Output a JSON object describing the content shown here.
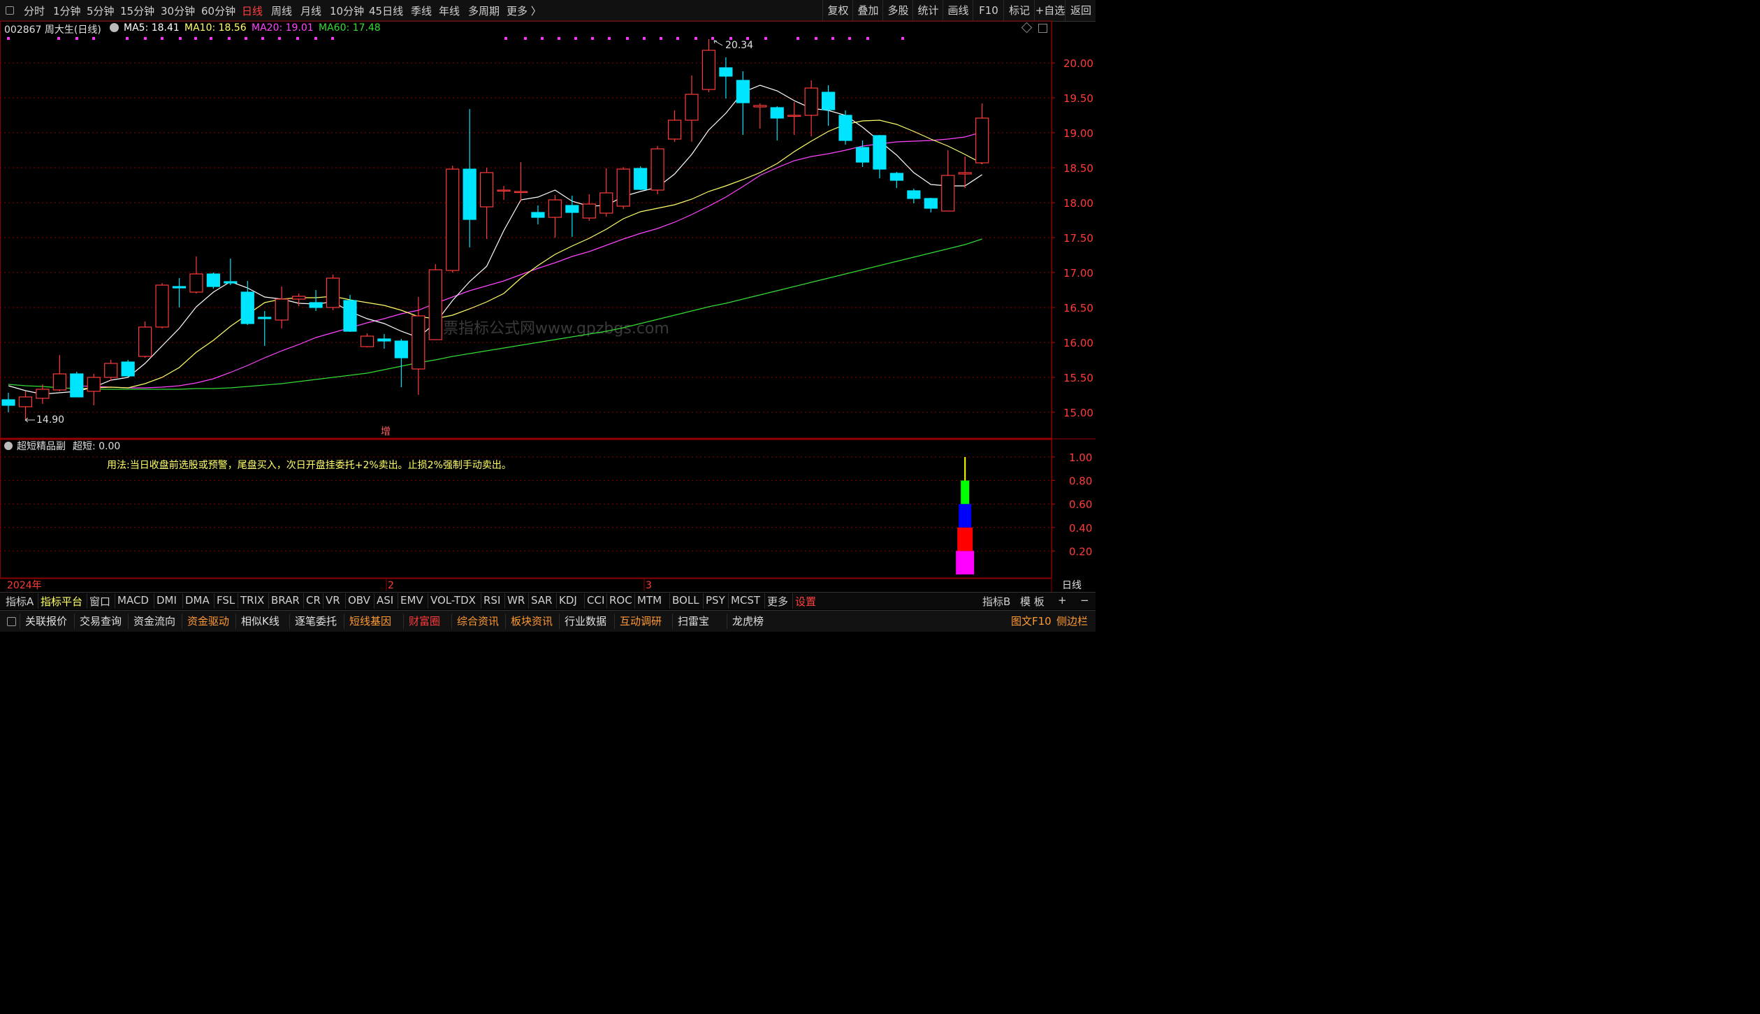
{
  "topbar": {
    "periods": [
      "分时",
      "1分钟",
      "5分钟",
      "15分钟",
      "30分钟",
      "60分钟",
      "日线",
      "周线",
      "月线",
      "10分钟",
      "45日线",
      "季线",
      "年线",
      "多周期",
      "更多 〉"
    ],
    "active_index": 6,
    "right_buttons": [
      "复权",
      "叠加",
      "多股",
      "统计",
      "画线",
      "F10",
      "标记",
      "+自选",
      "返回"
    ]
  },
  "info": {
    "code_name": "002867 周大生(日线)",
    "ma5": "MA5: 18.41",
    "ma10": "MA10: 18.56",
    "ma20": "MA20: 19.01",
    "ma60": "MA60: 17.48"
  },
  "colors": {
    "up": "#ff3b3b",
    "down": "#00e5ff",
    "ma5": "#ffffff",
    "ma10": "#ffff66",
    "ma20": "#ff44ff",
    "ma60": "#33dd33",
    "grid": "#8b0000"
  },
  "price_axis": [
    "20.00",
    "19.50",
    "19.00",
    "18.50",
    "18.00",
    "17.50",
    "17.00",
    "16.50",
    "16.00",
    "15.50",
    "15.00"
  ],
  "annotations": {
    "high": "20.34",
    "low": "14.90",
    "marker": "增",
    "watermark": "股票指标公式网www.gpzbgs.com"
  },
  "indicator": {
    "title": "超短精品副",
    "value": "超短: 0.00",
    "note": "用法:当日收盘前选股或预警，尾盘买入，次日开盘挂委托+2%卖出。止损2%强制手动卖出。",
    "axis": [
      "1.00",
      "0.80",
      "0.60",
      "0.40",
      "0.20"
    ]
  },
  "time_axis": {
    "year": "2024年",
    "m2": "2",
    "m3": "3",
    "period": "日线"
  },
  "indicator_tabs": [
    "指标A",
    "指标平台",
    "窗口",
    "MACD",
    "DMI",
    "DMA",
    "FSL",
    "TRIX",
    "BRAR",
    "CR",
    "VR",
    "OBV",
    "ASI",
    "EMV",
    "VOL-TDX",
    "RSI",
    "WR",
    "SAR",
    "KDJ",
    "CCI",
    "ROC",
    "MTM",
    "BOLL",
    "PSY",
    "MCST",
    "更多",
    "设置"
  ],
  "indicator_tabs_right": [
    "指标B",
    "模 板",
    "+",
    "−"
  ],
  "function_bar": [
    "关联报价",
    "交易查询",
    "资金流向",
    "资金驱动",
    "相似K线",
    "逐笔委托",
    "短线基因",
    "财富圈",
    "综合资讯",
    "板块资讯",
    "行业数据",
    "互动调研",
    "扫雷宝",
    "龙虎榜"
  ],
  "function_bar_right": [
    "图文F10",
    "侧边栏"
  ],
  "chart_data": {
    "type": "candlestick",
    "ylim": [
      14.75,
      20.55
    ],
    "candles": [
      {
        "o": 15.18,
        "h": 15.28,
        "l": 15.0,
        "c": 15.1
      },
      {
        "o": 15.08,
        "h": 15.3,
        "l": 14.9,
        "c": 15.22
      },
      {
        "o": 15.2,
        "h": 15.4,
        "l": 15.12,
        "c": 15.33
      },
      {
        "o": 15.32,
        "h": 15.82,
        "l": 15.3,
        "c": 15.55
      },
      {
        "o": 15.55,
        "h": 15.58,
        "l": 15.22,
        "c": 15.22
      },
      {
        "o": 15.3,
        "h": 15.55,
        "l": 15.1,
        "c": 15.5
      },
      {
        "o": 15.5,
        "h": 15.75,
        "l": 15.45,
        "c": 15.7
      },
      {
        "o": 15.72,
        "h": 15.75,
        "l": 15.52,
        "c": 15.52
      },
      {
        "o": 15.8,
        "h": 16.3,
        "l": 15.78,
        "c": 16.22
      },
      {
        "o": 16.22,
        "h": 16.85,
        "l": 16.2,
        "c": 16.82
      },
      {
        "o": 16.8,
        "h": 16.92,
        "l": 16.5,
        "c": 16.78
      },
      {
        "o": 16.72,
        "h": 17.23,
        "l": 16.7,
        "c": 16.98
      },
      {
        "o": 16.98,
        "h": 17.0,
        "l": 16.77,
        "c": 16.8
      },
      {
        "o": 16.87,
        "h": 17.2,
        "l": 16.82,
        "c": 16.85
      },
      {
        "o": 16.72,
        "h": 16.88,
        "l": 16.25,
        "c": 16.27
      },
      {
        "o": 16.36,
        "h": 16.45,
        "l": 15.95,
        "c": 16.34
      },
      {
        "o": 16.32,
        "h": 16.8,
        "l": 16.2,
        "c": 16.62
      },
      {
        "o": 16.62,
        "h": 16.7,
        "l": 16.52,
        "c": 16.66
      },
      {
        "o": 16.57,
        "h": 16.75,
        "l": 16.45,
        "c": 16.5
      },
      {
        "o": 16.5,
        "h": 16.97,
        "l": 16.46,
        "c": 16.92
      },
      {
        "o": 16.6,
        "h": 16.68,
        "l": 16.15,
        "c": 16.16
      },
      {
        "o": 15.94,
        "h": 16.13,
        "l": 15.93,
        "c": 16.09
      },
      {
        "o": 16.05,
        "h": 16.12,
        "l": 15.91,
        "c": 16.02
      },
      {
        "o": 16.02,
        "h": 16.05,
        "l": 15.36,
        "c": 15.78
      },
      {
        "o": 15.62,
        "h": 16.65,
        "l": 15.25,
        "c": 16.38
      },
      {
        "o": 16.04,
        "h": 17.12,
        "l": 16.04,
        "c": 17.04
      },
      {
        "o": 17.03,
        "h": 18.53,
        "l": 17.0,
        "c": 18.48
      },
      {
        "o": 18.48,
        "h": 19.34,
        "l": 17.36,
        "c": 17.76
      },
      {
        "o": 17.94,
        "h": 18.5,
        "l": 17.48,
        "c": 18.43
      },
      {
        "o": 18.18,
        "h": 18.24,
        "l": 18.04,
        "c": 18.18
      },
      {
        "o": 18.16,
        "h": 18.58,
        "l": 18.02,
        "c": 18.16
      },
      {
        "o": 17.86,
        "h": 17.96,
        "l": 17.69,
        "c": 17.79
      },
      {
        "o": 17.79,
        "h": 18.11,
        "l": 17.5,
        "c": 18.04
      },
      {
        "o": 17.96,
        "h": 18.1,
        "l": 17.51,
        "c": 17.86
      },
      {
        "o": 17.78,
        "h": 18.12,
        "l": 17.74,
        "c": 17.98
      },
      {
        "o": 17.85,
        "h": 18.49,
        "l": 17.8,
        "c": 18.14
      },
      {
        "o": 17.95,
        "h": 18.51,
        "l": 17.91,
        "c": 18.48
      },
      {
        "o": 18.49,
        "h": 18.52,
        "l": 18.18,
        "c": 18.19
      },
      {
        "o": 18.18,
        "h": 18.81,
        "l": 18.12,
        "c": 18.77
      },
      {
        "o": 18.91,
        "h": 19.32,
        "l": 18.87,
        "c": 19.18
      },
      {
        "o": 19.18,
        "h": 19.82,
        "l": 18.87,
        "c": 19.55
      },
      {
        "o": 19.62,
        "h": 20.34,
        "l": 19.58,
        "c": 20.18
      },
      {
        "o": 19.93,
        "h": 20.08,
        "l": 19.49,
        "c": 19.81
      },
      {
        "o": 19.75,
        "h": 19.88,
        "l": 18.97,
        "c": 19.43
      },
      {
        "o": 19.37,
        "h": 19.42,
        "l": 19.06,
        "c": 19.39
      },
      {
        "o": 19.36,
        "h": 19.38,
        "l": 18.89,
        "c": 19.21
      },
      {
        "o": 19.24,
        "h": 19.44,
        "l": 18.97,
        "c": 19.25
      },
      {
        "o": 19.25,
        "h": 19.75,
        "l": 18.95,
        "c": 19.64
      },
      {
        "o": 19.58,
        "h": 19.68,
        "l": 19.1,
        "c": 19.33
      },
      {
        "o": 19.25,
        "h": 19.32,
        "l": 18.83,
        "c": 18.89
      },
      {
        "o": 18.79,
        "h": 18.89,
        "l": 18.51,
        "c": 18.58
      },
      {
        "o": 18.96,
        "h": 18.97,
        "l": 18.35,
        "c": 18.48
      },
      {
        "o": 18.42,
        "h": 18.44,
        "l": 18.21,
        "c": 18.32
      },
      {
        "o": 18.17,
        "h": 18.2,
        "l": 17.99,
        "c": 18.06
      },
      {
        "o": 18.06,
        "h": 18.07,
        "l": 17.86,
        "c": 17.92
      },
      {
        "o": 17.88,
        "h": 18.75,
        "l": 17.88,
        "c": 18.39
      },
      {
        "o": 18.41,
        "h": 18.66,
        "l": 18.21,
        "c": 18.43
      },
      {
        "o": 18.57,
        "h": 19.42,
        "l": 18.55,
        "c": 19.21
      }
    ],
    "ma5": [
      15.38,
      15.31,
      15.26,
      15.28,
      15.3,
      15.36,
      15.46,
      15.5,
      15.7,
      15.95,
      16.2,
      16.51,
      16.72,
      16.87,
      16.78,
      16.65,
      16.62,
      16.56,
      16.55,
      16.58,
      16.44,
      16.34,
      16.27,
      16.16,
      16.07,
      16.28,
      16.6,
      16.87,
      17.09,
      17.6,
      18.04,
      18.08,
      18.18,
      18.02,
      17.95,
      17.96,
      18.09,
      18.16,
      18.22,
      18.41,
      18.69,
      19.04,
      19.28,
      19.58,
      19.68,
      19.6,
      19.46,
      19.35,
      19.32,
      19.25,
      19.08,
      18.88,
      18.68,
      18.43,
      18.26,
      18.24,
      18.24,
      18.4
    ],
    "ma10": [
      null,
      null,
      null,
      null,
      15.33,
      15.35,
      15.36,
      15.35,
      15.41,
      15.5,
      15.64,
      15.86,
      16.03,
      16.23,
      16.4,
      16.57,
      16.62,
      16.64,
      16.64,
      16.66,
      16.61,
      16.57,
      16.53,
      16.46,
      16.37,
      16.34,
      16.39,
      16.48,
      16.58,
      16.7,
      16.92,
      17.1,
      17.26,
      17.38,
      17.49,
      17.62,
      17.77,
      17.87,
      17.92,
      17.97,
      18.05,
      18.16,
      18.24,
      18.33,
      18.43,
      18.56,
      18.73,
      18.88,
      19.02,
      19.12,
      19.17,
      19.18,
      19.12,
      19.02,
      18.91,
      18.81,
      18.69,
      18.56
    ],
    "ma20": [
      null,
      null,
      null,
      null,
      15.38,
      15.37,
      15.36,
      15.35,
      15.35,
      15.36,
      15.38,
      15.42,
      15.48,
      15.57,
      15.67,
      15.78,
      15.88,
      15.97,
      16.07,
      16.14,
      16.21,
      16.28,
      16.34,
      16.41,
      16.46,
      16.56,
      16.65,
      16.74,
      16.81,
      16.88,
      16.97,
      17.06,
      17.14,
      17.23,
      17.3,
      17.39,
      17.48,
      17.56,
      17.63,
      17.72,
      17.83,
      17.95,
      18.08,
      18.23,
      18.39,
      18.5,
      18.6,
      18.66,
      18.7,
      18.75,
      18.81,
      18.84,
      18.87,
      18.88,
      18.89,
      18.91,
      18.94,
      19.01
    ],
    "ma60": [
      15.47,
      15.44,
      15.42,
      15.4,
      15.38,
      15.37,
      15.35,
      15.34,
      15.33,
      15.33,
      15.33,
      15.33,
      15.33,
      15.33,
      15.34,
      15.34,
      15.35,
      15.37,
      15.39,
      15.41,
      15.44,
      15.47,
      15.5,
      15.53,
      15.56,
      15.61,
      15.66,
      15.71,
      15.75,
      15.8,
      15.84,
      15.88,
      15.92,
      15.96,
      16.0,
      16.04,
      16.08,
      16.12,
      16.16,
      16.21,
      16.27,
      16.33,
      16.39,
      16.45,
      16.51,
      16.56,
      16.62,
      16.68,
      16.74,
      16.8,
      16.86,
      16.92,
      16.98,
      17.04,
      17.1,
      17.16,
      17.22,
      17.28,
      17.34,
      17.4,
      17.48
    ],
    "indicator_bar": {
      "index": 56,
      "max": 1.0,
      "segments": [
        {
          "from": 0.0,
          "to": 0.2,
          "color": "#ff00ff"
        },
        {
          "from": 0.2,
          "to": 0.4,
          "color": "#ff0000"
        },
        {
          "from": 0.4,
          "to": 0.6,
          "color": "#0000ff"
        },
        {
          "from": 0.6,
          "to": 0.8,
          "color": "#00ff00"
        },
        {
          "from": 0.8,
          "to": 1.0,
          "color": "#ffff00",
          "line": true
        }
      ]
    }
  }
}
